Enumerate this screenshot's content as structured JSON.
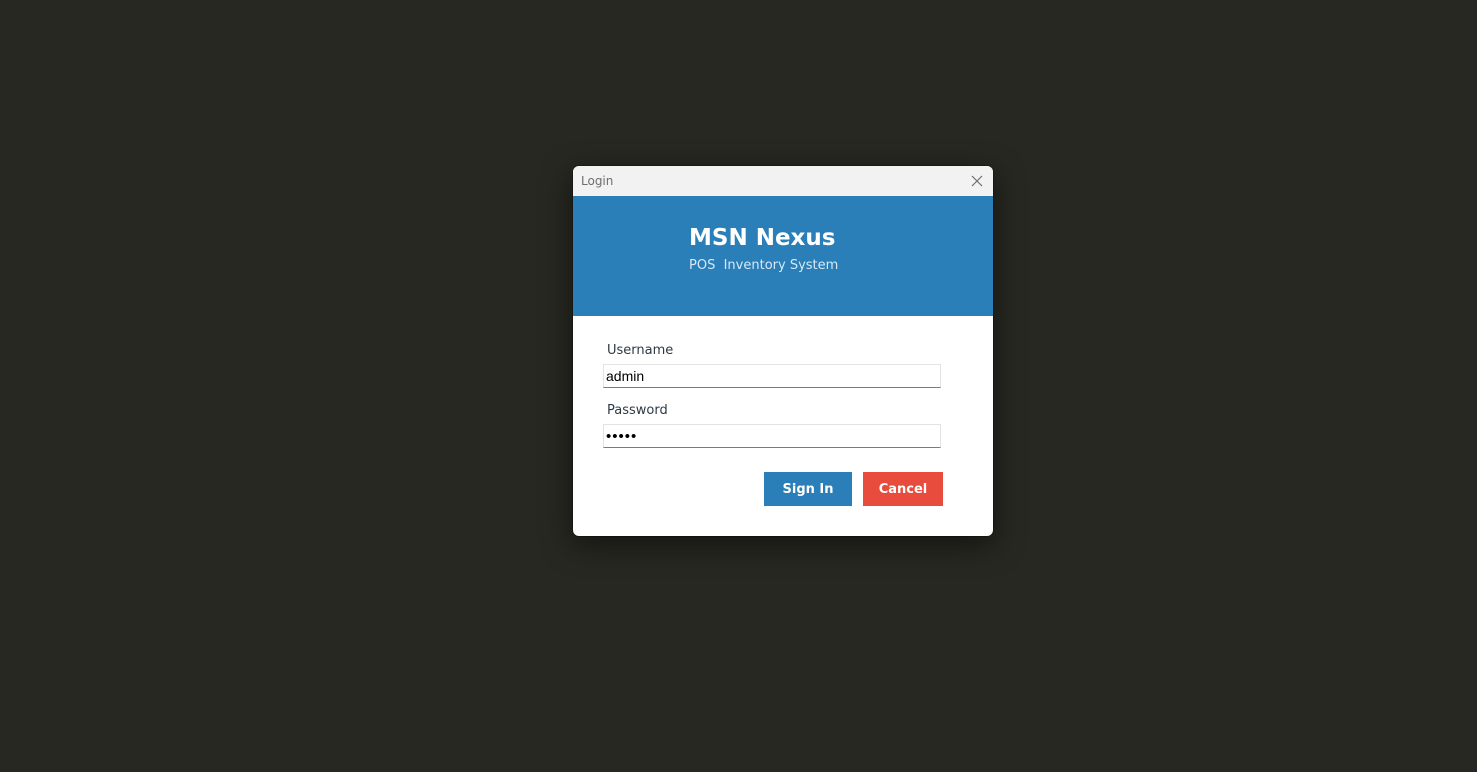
{
  "window": {
    "title": "Login",
    "close_icon": "close-icon"
  },
  "banner": {
    "title": "MSN Nexus",
    "subtitle": "POS  Inventory System",
    "color": "#2a7fb8"
  },
  "form": {
    "username_label": "Username",
    "username_value": "admin",
    "password_label": "Password",
    "password_value": "admin"
  },
  "buttons": {
    "sign_in_label": "Sign In",
    "sign_in_color": "#2a7fb8",
    "cancel_label": "Cancel",
    "cancel_color": "#e84c3d"
  }
}
